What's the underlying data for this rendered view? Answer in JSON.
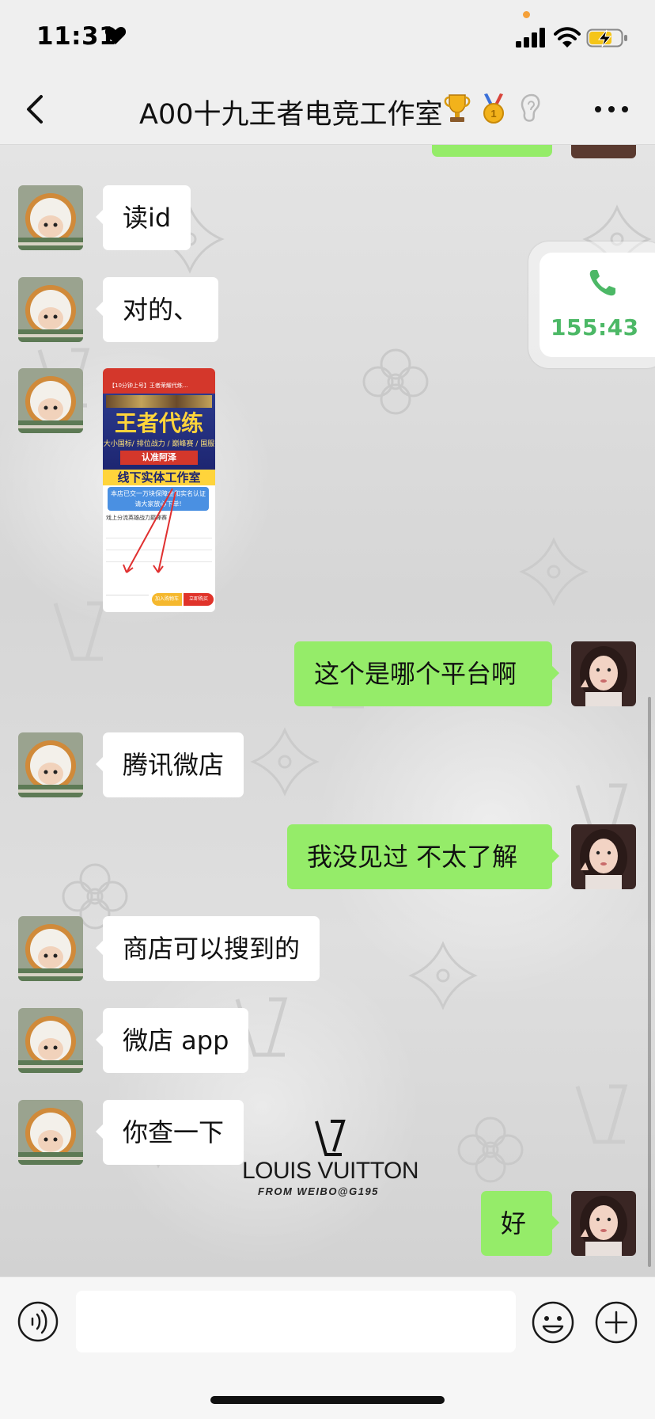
{
  "status_bar": {
    "time": "11:31",
    "battery_state": "charging",
    "accent_dot_color": "#f5a13a"
  },
  "nav": {
    "title": "A00十九王者电竞工作室",
    "title_emojis": [
      "trophy-icon",
      "gold-medal-icon",
      "ear-icon"
    ]
  },
  "messages": [
    {
      "side": "left",
      "type": "text",
      "text": "读id"
    },
    {
      "side": "left",
      "type": "text",
      "text": "对的、"
    },
    {
      "side": "left",
      "type": "image",
      "image": {
        "header": "【10分钟上号】王者荣耀代练...",
        "banner_title": "王者代练",
        "banner_sub": "大小国标/ 排位战力 / 巅峰赛 / 国服",
        "badge": "认准阿泽",
        "bottom_banner": "线下实体工作室",
        "notice": "本店已交一万块保障金和实名认证 请大家放心下单!",
        "product": "戏上分流英雄战力巅峰赛",
        "button_left": "加入购物车",
        "button_right": "立即购买"
      }
    },
    {
      "side": "right",
      "type": "text",
      "text": "这个是哪个平台啊"
    },
    {
      "side": "left",
      "type": "text",
      "text": "腾讯微店"
    },
    {
      "side": "right",
      "type": "text",
      "text": "我没见过 不太了解"
    },
    {
      "side": "left",
      "type": "text",
      "text": "商店可以搜到的"
    },
    {
      "side": "left",
      "type": "text",
      "text": "微店 app"
    },
    {
      "side": "left",
      "type": "text",
      "text": "你查一下"
    },
    {
      "side": "right",
      "type": "text",
      "text": "好"
    }
  ],
  "call_widget": {
    "duration": "155:43",
    "icon": "phone-icon",
    "color": "#4cb866"
  },
  "watermark": {
    "brand": "LOUIS VUITTON",
    "credit": "FROM WEIBO@G195"
  },
  "input_bar": {
    "value": "",
    "voice_icon": "voice-icon",
    "emoji_icon": "emoji-icon",
    "plus_icon": "plus-icon"
  },
  "colors": {
    "bubble_sent": "#95ec69",
    "bubble_received": "#ffffff",
    "bar_bg": "#efefef"
  }
}
